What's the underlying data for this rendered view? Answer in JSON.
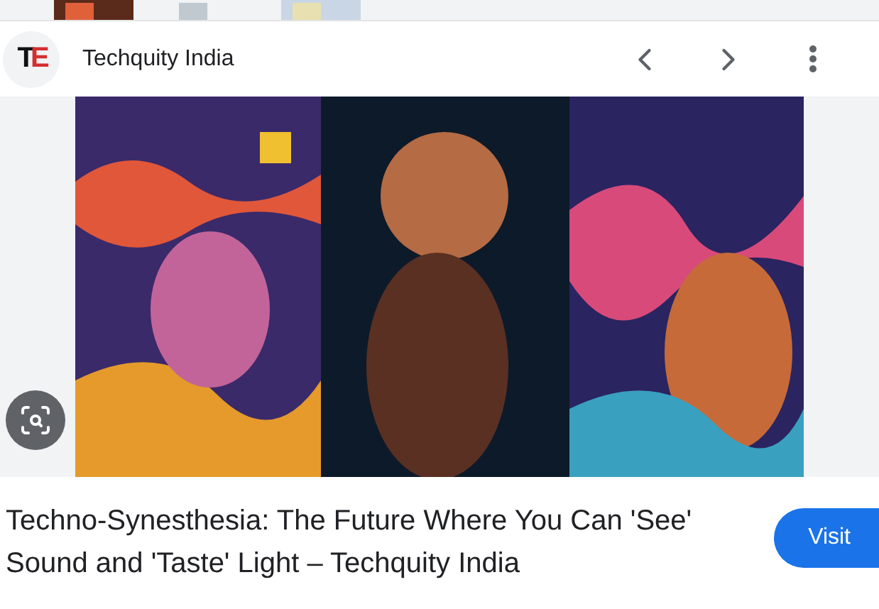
{
  "header": {
    "source": "Techquity India",
    "logo_letters": "TE"
  },
  "result": {
    "title": "Techno-Synesthesia: The Future Where You Can 'See' Sound and 'Taste' Light – Techquity India",
    "button": "Visit"
  }
}
